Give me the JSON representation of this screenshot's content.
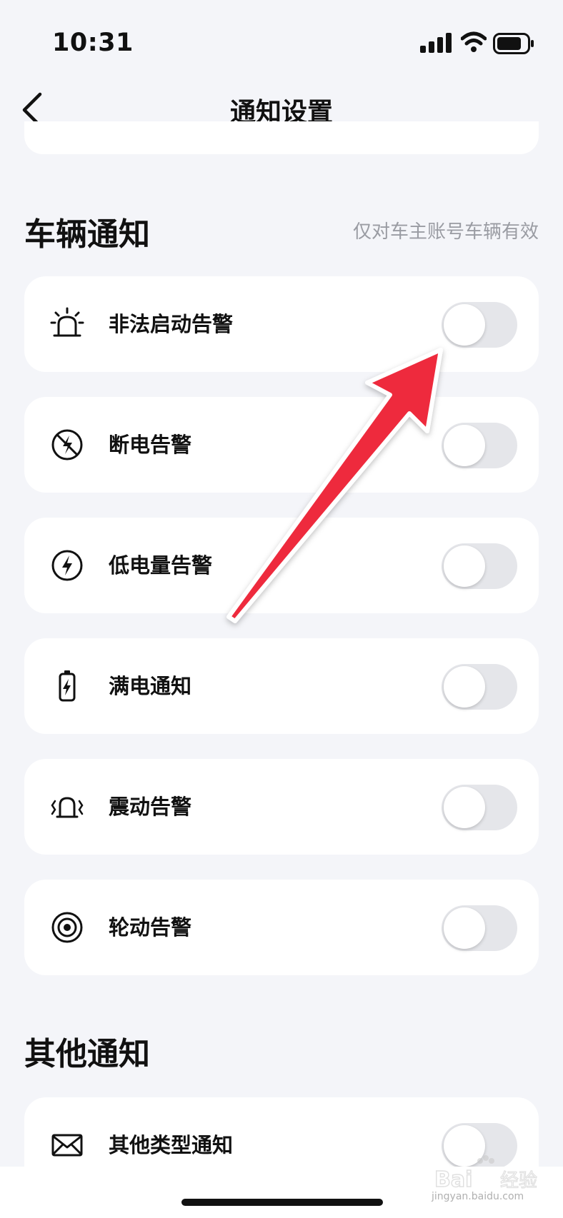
{
  "status_bar": {
    "time": "10:31"
  },
  "nav": {
    "title": "通知设置"
  },
  "vehicle_section": {
    "title": "车辆通知",
    "hint": "仅对车主账号车辆有效",
    "items": [
      {
        "label": "非法启动告警",
        "icon": "alarm-light-icon",
        "enabled": false
      },
      {
        "label": "断电告警",
        "icon": "power-off-icon",
        "enabled": false
      },
      {
        "label": "低电量告警",
        "icon": "low-battery-bolt-icon",
        "enabled": false
      },
      {
        "label": "满电通知",
        "icon": "battery-charging-icon",
        "enabled": false
      },
      {
        "label": "震动告警",
        "icon": "vibration-alarm-icon",
        "enabled": false
      },
      {
        "label": "轮动告警",
        "icon": "wheel-target-icon",
        "enabled": false
      }
    ]
  },
  "other_section": {
    "title": "其他通知",
    "items": [
      {
        "label": "其他类型通知",
        "icon": "mail-icon",
        "enabled": false
      }
    ]
  },
  "colors": {
    "arrow": "#ee2a3c",
    "background": "#f4f5f9",
    "toggle_off": "#e5e6ea"
  },
  "watermark": {
    "caption": "jingyan.baidu.com"
  }
}
